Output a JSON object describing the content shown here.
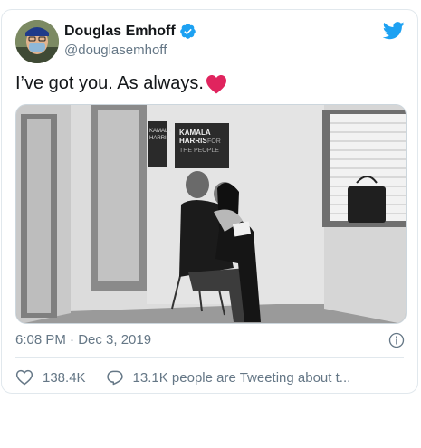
{
  "tweet": {
    "author_name": "Douglas Emhoff",
    "author_handle": "@douglasemhoff",
    "text": "I’ve got you. As always.",
    "timestamp": "6:08 PM · Dec 3, 2019",
    "likes": "138.4K",
    "conversation": "13.1K people are Tweeting about t..."
  },
  "photo": {
    "poster_top": "KAMALA",
    "poster_mid": "HARRIS",
    "poster_for": "FOR",
    "poster_bottom": "THE PEOPLE",
    "poster_small_1": "KAMALA",
    "poster_small_2": "HARRIS"
  },
  "icons": {
    "verified": "verified-badge-icon",
    "bird": "twitter-bird-icon",
    "heart_emoji": "red-heart-icon",
    "info": "info-icon",
    "like": "heart-outline-icon",
    "reply": "speech-bubble-icon"
  },
  "colors": {
    "twitter_blue": "#1da1f2",
    "heart_red": "#e0245e",
    "muted": "#657786"
  }
}
